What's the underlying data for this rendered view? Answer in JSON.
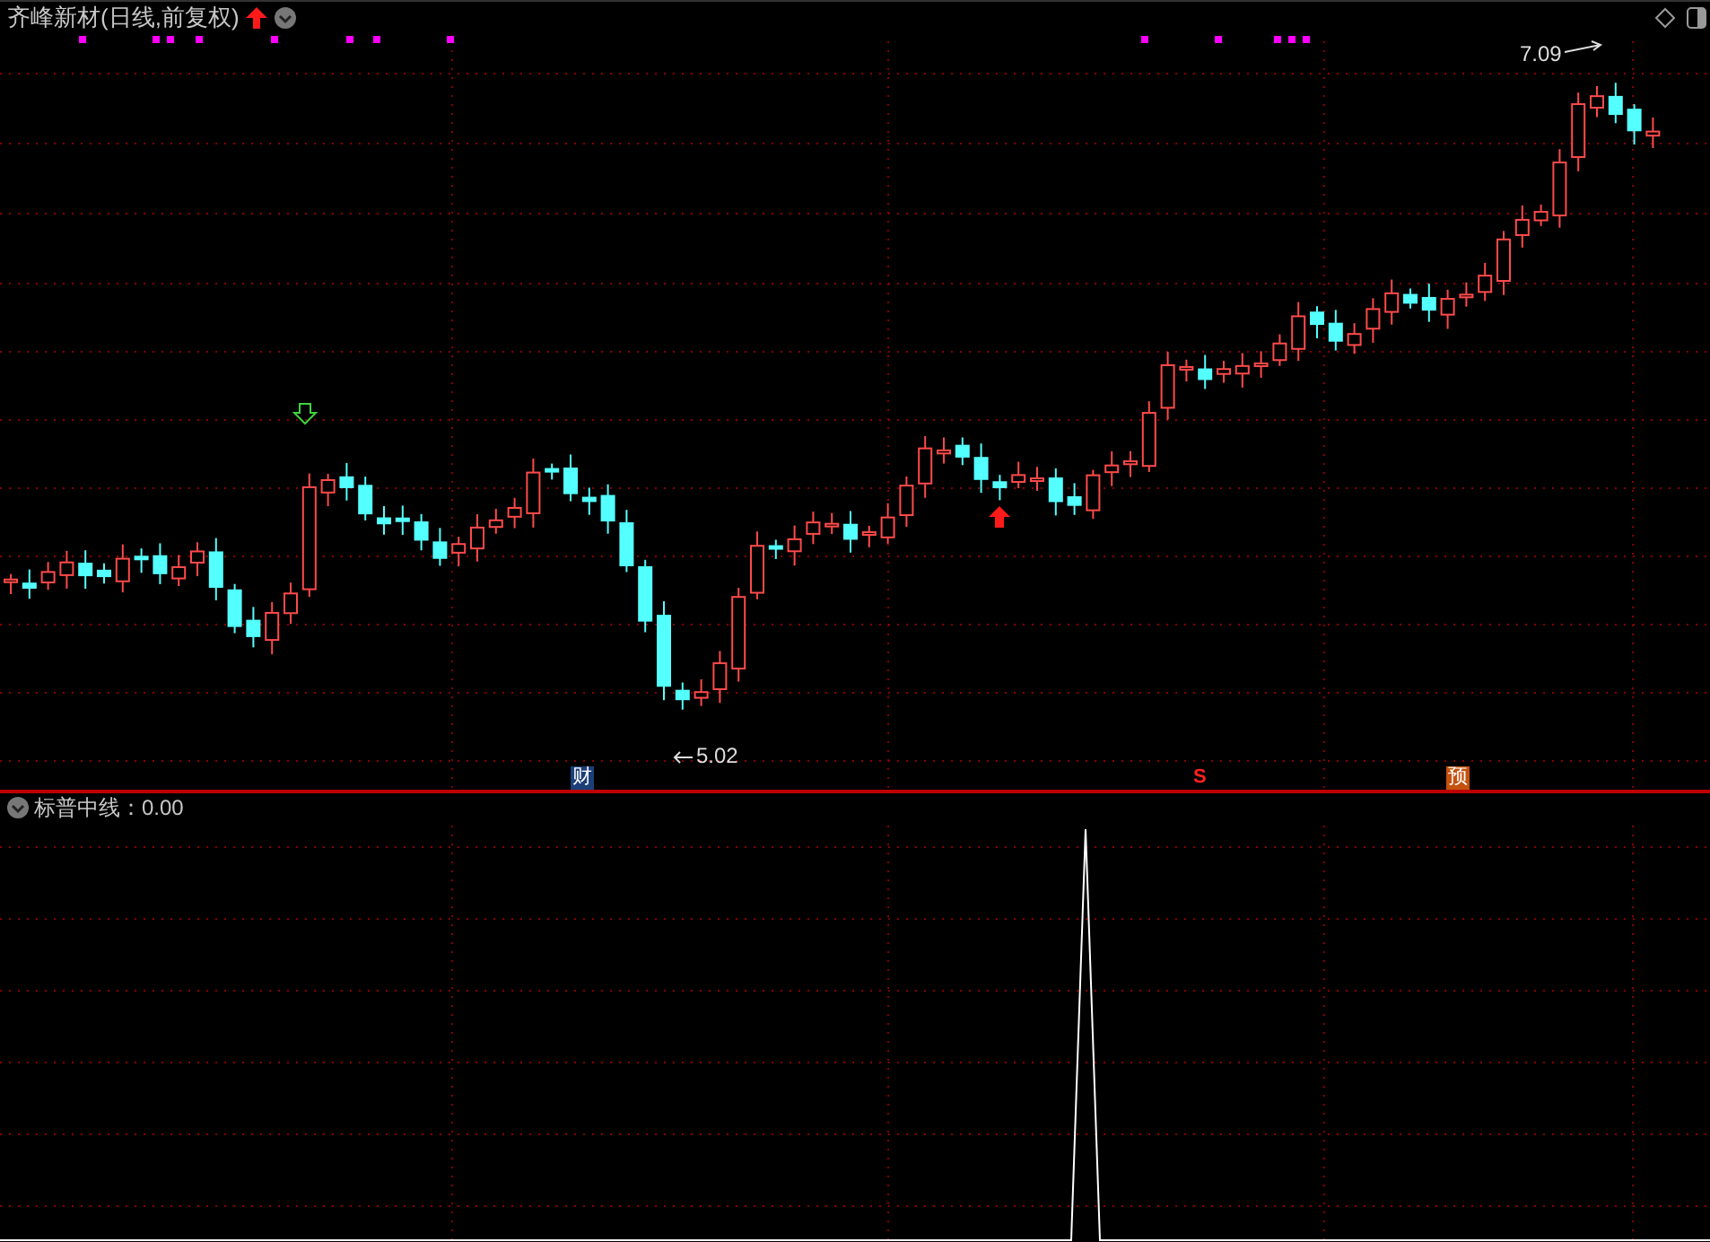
{
  "window": {
    "title": "齐峰新材(日线,前复权)"
  },
  "price_chart": {
    "high_label": "7.09",
    "low_label": "5.02",
    "event_markers": [
      {
        "kind": "finance",
        "label": "财"
      },
      {
        "kind": "signal",
        "label": "S"
      },
      {
        "kind": "forecast",
        "label": "预"
      }
    ]
  },
  "indicator": {
    "label": "标普中线：0.00"
  }
}
